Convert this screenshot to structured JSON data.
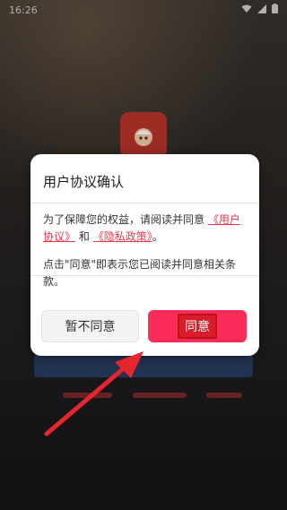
{
  "status_bar": {
    "time": "16:26"
  },
  "dialog": {
    "title": "用户协议确认",
    "body_prefix": "为了保障您的权益，请阅读并同意",
    "user_agreement_link": "《用户协议》",
    "and_text": "和",
    "privacy_link": "《隐私政策》",
    "period": "。",
    "notice": "点击\"同意\"即表示您已阅读并同意相关条款。",
    "decline_label": "暂不同意",
    "agree_label": "同意"
  },
  "colors": {
    "accent": "#fb2d58",
    "link": "#e8374d",
    "annotation_arrow": "#e5262f"
  }
}
